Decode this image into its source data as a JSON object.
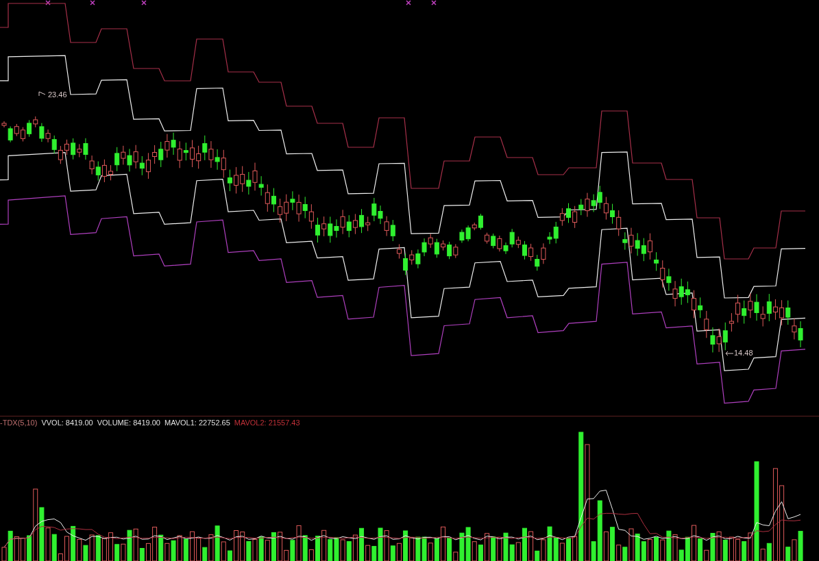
{
  "price_panel": {
    "high_label": "23.46",
    "low_label": "14.48"
  },
  "volume_panel": {
    "indicator": {
      "text": "-TDX(5,10)",
      "color": "#c07070"
    },
    "readings": [
      {
        "text": "VVOL: 8419.00",
        "color": "#e0e0e0"
      },
      {
        "text": "VOLUME: 8419.00",
        "color": "#e0e0e0"
      },
      {
        "text": "MAVOL1: 22752.65",
        "color": "#e0e0e0"
      },
      {
        "text": "MAVOL2: 21557.43",
        "color": "#c03038"
      }
    ]
  }
}
